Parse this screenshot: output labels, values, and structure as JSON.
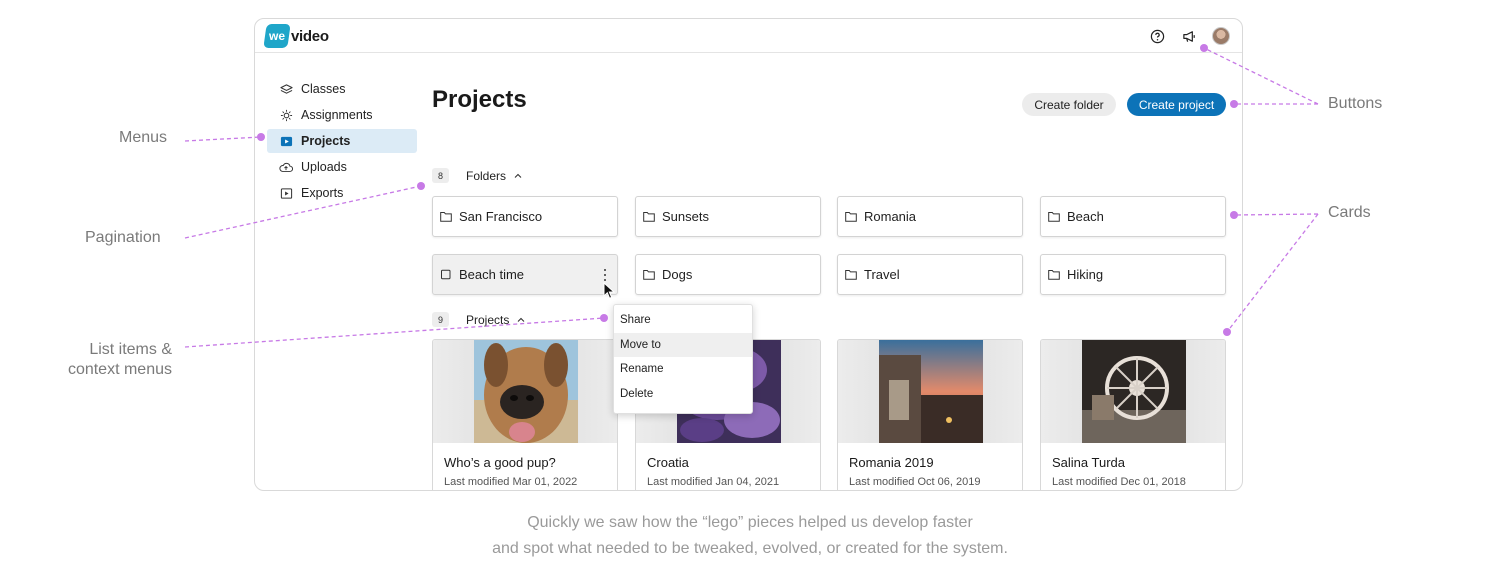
{
  "app": {
    "logo_mark": "we",
    "logo_text": "video"
  },
  "topbar": {
    "icons": [
      "help-icon",
      "megaphone-icon",
      "user-avatar"
    ]
  },
  "sidebar": {
    "items": [
      {
        "label": "Classes",
        "icon": "layers-icon",
        "active": false
      },
      {
        "label": "Assignments",
        "icon": "lightbulb-icon",
        "active": false
      },
      {
        "label": "Projects",
        "icon": "play-icon",
        "active": true
      },
      {
        "label": "Uploads",
        "icon": "cloud-upload-icon",
        "active": false
      },
      {
        "label": "Exports",
        "icon": "export-icon",
        "active": false
      }
    ]
  },
  "main": {
    "title": "Projects",
    "create_folder_label": "Create folder",
    "create_project_label": "Create project",
    "folders_section": {
      "count": "8",
      "label": "Folders"
    },
    "folders": [
      {
        "name": "San Francisco"
      },
      {
        "name": "Sunsets"
      },
      {
        "name": "Romania"
      },
      {
        "name": "Beach"
      },
      {
        "name": "Beach time"
      },
      {
        "name": "Dogs"
      },
      {
        "name": "Travel"
      },
      {
        "name": "Hiking"
      }
    ],
    "projects_section": {
      "count": "9",
      "label": "Projects"
    },
    "projects": [
      {
        "title": "Who’s a good pup?",
        "modified": "Last modified Mar 01, 2022"
      },
      {
        "title": "Croatia",
        "modified": "Last modified Jan 04, 2021"
      },
      {
        "title": "Romania 2019",
        "modified": "Last modified Oct 06, 2019"
      },
      {
        "title": "Salina Turda",
        "modified": "Last modified Dec 01, 2018"
      }
    ],
    "context_menu": [
      "Share",
      "Move to",
      "Rename",
      "Delete"
    ]
  },
  "annotations": {
    "menus": "Menus",
    "pagination": "Pagination",
    "list_items_line1": "List items &",
    "list_items_line2": "context menus",
    "buttons": "Buttons",
    "cards": "Cards"
  },
  "caption": {
    "line1": "Quickly we saw how the “lego” pieces helped us develop faster",
    "line2": "and spot what needed to be tweaked, evolved, or created for the system."
  },
  "colors": {
    "accent": "#0c73b8",
    "active_menu_bg": "#dcebf6",
    "annotation_line": "#c77ae6",
    "logo": "#1fa6c9"
  }
}
